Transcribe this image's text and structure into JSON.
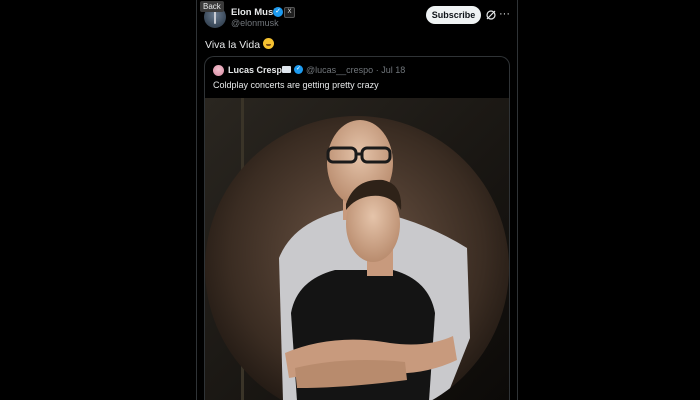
{
  "tweet": {
    "back_label": "Back",
    "author_name": "Elon Musk",
    "handle": "@elonmusk",
    "subscribe_label": "Subscribe",
    "text": "Viva la Vida",
    "emoji_icon": "grinning-squinting-face-icon"
  },
  "quoted": {
    "author_name": "Lucas Crespo",
    "handle": "@lucas__crespo",
    "separator": "·",
    "date": "Jul 18",
    "text": "Coldplay concerts are getting pretty crazy"
  },
  "colors": {
    "background": "#000000",
    "text_primary": "#e7e9ea",
    "text_secondary": "#71767b",
    "border": "#2f3336",
    "accent_blue": "#1d9bf0",
    "subscribe_bg": "#eff3f4"
  }
}
